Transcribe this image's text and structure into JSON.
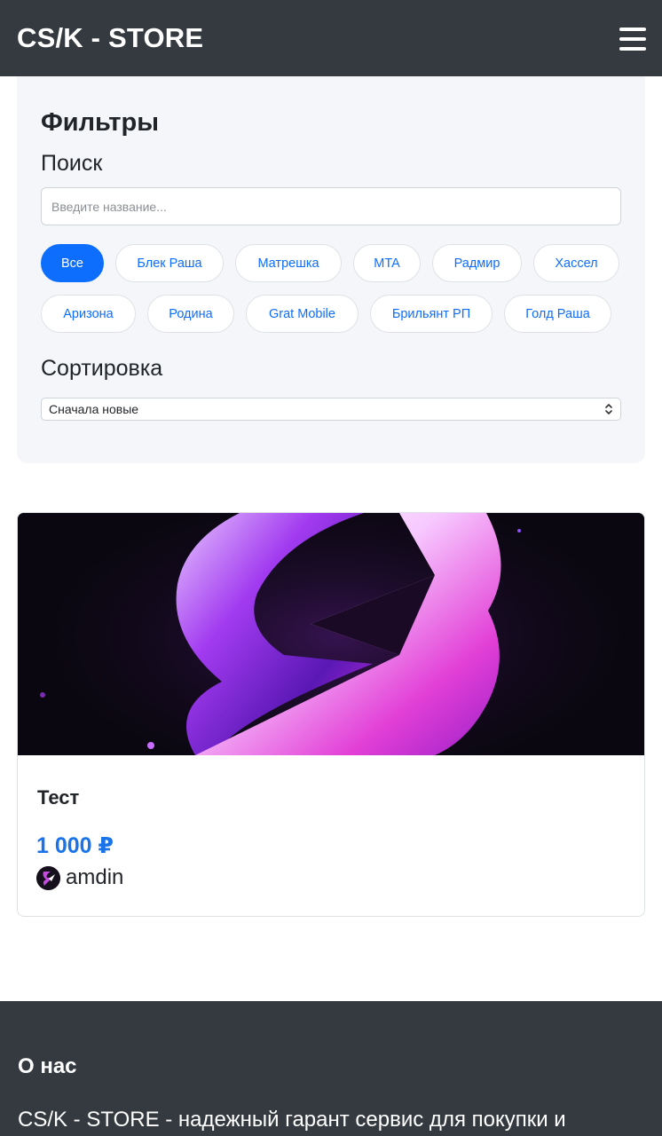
{
  "header": {
    "brand": "CS/K - STORE",
    "menu_icon": "hamburger-menu-icon"
  },
  "filters": {
    "title": "Фильтры",
    "search_label": "Поиск",
    "search_placeholder": "Введите название...",
    "search_value": "",
    "categories": [
      {
        "label": "Все",
        "active": true
      },
      {
        "label": "Блек Раша",
        "active": false
      },
      {
        "label": "Матрешка",
        "active": false
      },
      {
        "label": "MTA",
        "active": false
      },
      {
        "label": "Радмир",
        "active": false
      },
      {
        "label": "Хассел",
        "active": false
      },
      {
        "label": "Аризона",
        "active": false
      },
      {
        "label": "Родина",
        "active": false
      },
      {
        "label": "Grat Mobile",
        "active": false
      },
      {
        "label": "Брильянт РП",
        "active": false
      },
      {
        "label": "Голд Раша",
        "active": false
      }
    ],
    "sort_label": "Сортировка",
    "sort_selected": "Сначала новые"
  },
  "products": [
    {
      "title": "Тест",
      "price": "1 000 ₽",
      "seller": "amdin",
      "image_icon": "store-logo-s-icon"
    }
  ],
  "footer": {
    "title": "О нас",
    "text": "CS/K - STORE - надежный гарант сервис для покупки и"
  },
  "colors": {
    "navbar": "#343a40",
    "accent": "#0d6efd",
    "price": "#1a73e8",
    "filter_bg": "#f4f6f9"
  }
}
